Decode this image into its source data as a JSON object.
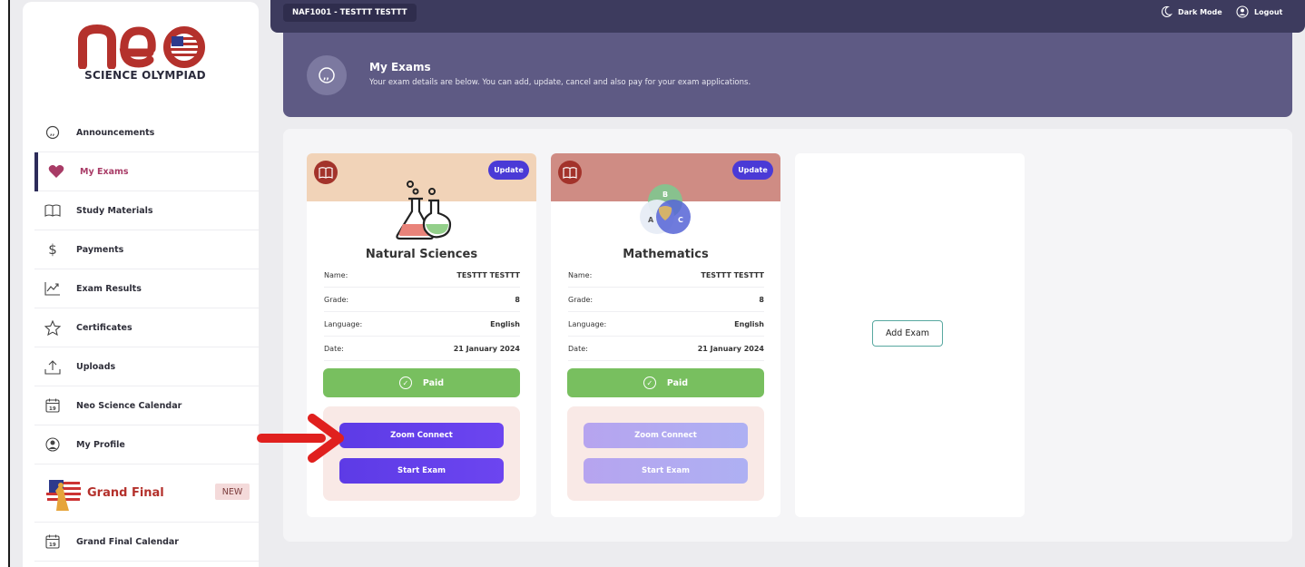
{
  "brand": {
    "logo_text": "neo",
    "subtitle": "SCIENCE OLYMPIAD"
  },
  "sidebar": {
    "items": [
      {
        "label": "Announcements",
        "icon": "chat-quote-icon"
      },
      {
        "label": "My Exams",
        "icon": "heart-icon"
      },
      {
        "label": "Study Materials",
        "icon": "book-open-icon"
      },
      {
        "label": "Payments",
        "icon": "dollar-icon"
      },
      {
        "label": "Exam Results",
        "icon": "trend-chart-icon"
      },
      {
        "label": "Certificates",
        "icon": "star-icon"
      },
      {
        "label": "Uploads",
        "icon": "upload-icon"
      },
      {
        "label": "Neo Science Calendar",
        "icon": "calendar-icon",
        "icon_text": "19"
      },
      {
        "label": "My Profile",
        "icon": "user-circle-icon"
      }
    ],
    "grand_final": {
      "label": "Grand Final",
      "badge": "NEW"
    },
    "grand_final_calendar": {
      "label": "Grand Final Calendar",
      "icon_text": "19"
    }
  },
  "topbar": {
    "user": "NAF1001 - TESTTT TESTTT",
    "dark_mode": "Dark Mode",
    "logout": "Logout"
  },
  "header": {
    "title": "My Exams",
    "subtitle": "Your exam details are below. You can add, update, cancel and also pay for your exam applications."
  },
  "exams": [
    {
      "subject": "Natural Sciences",
      "update_label": "Update",
      "fields": [
        {
          "label": "Name:",
          "value": "TESTTT TESTTT"
        },
        {
          "label": "Grade:",
          "value": "8"
        },
        {
          "label": "Language:",
          "value": "English"
        },
        {
          "label": "Date:",
          "value": "21 January 2024"
        }
      ],
      "status": "Paid",
      "zoom_label": "Zoom Connect",
      "start_label": "Start Exam",
      "header_color": "#f1d3b8"
    },
    {
      "subject": "Mathematics",
      "update_label": "Update",
      "fields": [
        {
          "label": "Name:",
          "value": "TESTTT TESTTT"
        },
        {
          "label": "Grade:",
          "value": "8"
        },
        {
          "label": "Language:",
          "value": "English"
        },
        {
          "label": "Date:",
          "value": "21 January 2024"
        }
      ],
      "status": "Paid",
      "zoom_label": "Zoom Connect",
      "start_label": "Start Exam",
      "header_color": "#cf8c84",
      "venn_labels": [
        "B",
        "A",
        "C"
      ]
    }
  ],
  "add_exam": {
    "label": "Add Exam"
  },
  "colors": {
    "topbar": "#3d3b5e",
    "header": "#5e5a84",
    "accent_purple": "#5d3be6",
    "paid_green": "#78bf5f",
    "arrow_red": "#e0201e"
  }
}
